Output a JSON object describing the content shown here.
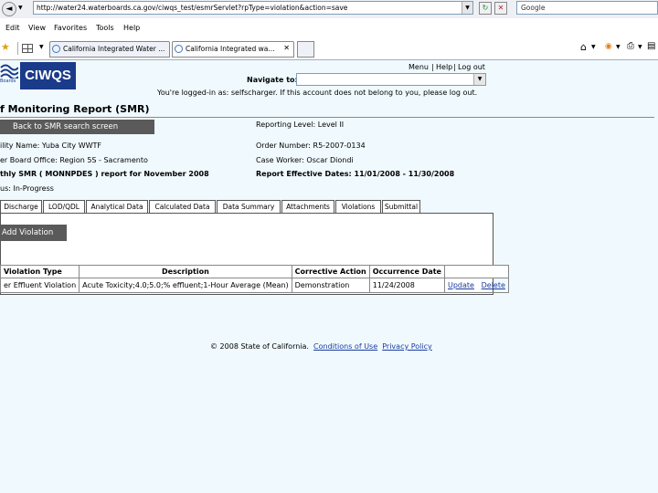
{
  "browser": {
    "address": "http://water24.waterboards.ca.gov/ciwqs_test/esmrServlet?rpType=violation&action=save",
    "search_placeholder": "Google",
    "menu": [
      "Edit",
      "View",
      "Favorites",
      "Tools",
      "Help"
    ],
    "tabs": [
      {
        "label": "California Integrated Water ..."
      },
      {
        "label": "California Integrated wa...",
        "active": true
      }
    ]
  },
  "header": {
    "logo_text": "CIWQS",
    "logo_sub": "Boards",
    "links": {
      "menu": "Menu",
      "sep1": "|",
      "help": "Help",
      "sep2": "|",
      "logout": "Log out"
    },
    "navigate_label": "Navigate to:",
    "navigate_value": "",
    "logged_in_text": "You're logged-in as: selfscharger. If this account does not belong to you, please log out."
  },
  "page": {
    "title": "f Monitoring Report (SMR)",
    "back_button": "Back to SMR search screen",
    "facility": "ility Name: Yuba City WWTF",
    "board_office": "er Board Office: Region 5S - Sacramento",
    "report": "thly SMR ( MONNPDES ) report for November 2008",
    "status": "us: In-Progress",
    "reporting_level": "Reporting Level: Level II",
    "order_number": "Order Number: R5-2007-0134",
    "case_worker": "Case Worker: Oscar Diondi",
    "effective_dates": "Report Effective Dates: 11/01/2008 - 11/30/2008"
  },
  "content_tabs": [
    "Discharge",
    "LOD/QDL",
    "Analytical Data",
    "Calculated Data",
    "Data Summary",
    "Attachments",
    "Violations",
    "Submittal"
  ],
  "active_tab": "Violations",
  "violations": {
    "add_button": "Add Violation",
    "columns": [
      "Violation Type",
      "Description",
      "Corrective Action",
      "Occurrence Date",
      ""
    ],
    "rows": [
      {
        "type": "er Effluent Violation",
        "description": "Acute Toxicity;4.0;5.0;% effluent;1-Hour Average (Mean)",
        "corrective_action": "Demonstration",
        "date": "11/24/2008",
        "update": "Update",
        "delete": "Delete"
      }
    ]
  },
  "footer": {
    "copyright": "© 2008 State of California.",
    "conditions": "Conditions of Use",
    "privacy": "Privacy Policy"
  },
  "colors": {
    "logo_blue": "#1a3a8a",
    "button_grey": "#5a5a5a",
    "background": "#f0fafe"
  }
}
